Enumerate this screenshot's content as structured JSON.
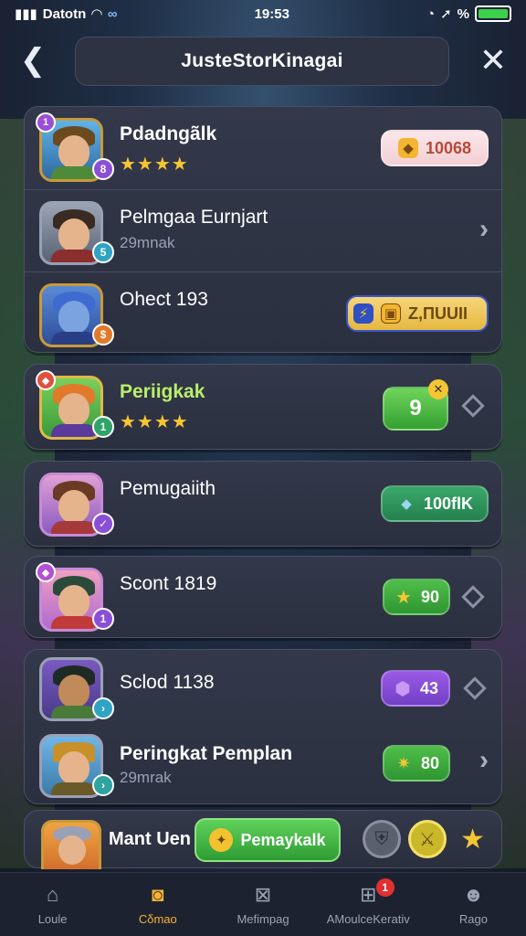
{
  "status_bar": {
    "carrier": "Datotn",
    "time": "19:53",
    "battery": "%"
  },
  "header": {
    "title": "JusteStorKinagai"
  },
  "rows": [
    {
      "name": "Pdadngãlk",
      "subtitle": "",
      "stars": "★★★★",
      "pill_value": "10068",
      "trailing": ""
    },
    {
      "name": "Pelmgaa Eurnjart",
      "subtitle": "29mnak",
      "stars": "",
      "pill_value": "",
      "trailing": "chevron"
    },
    {
      "name": "Ohect 193",
      "subtitle": "",
      "stars": "",
      "pill_value": "Z,ΠUUII",
      "trailing": ""
    },
    {
      "name": "Periigkak",
      "subtitle": "",
      "stars": "★★★★",
      "pill_value": "9",
      "trailing": "diamond"
    },
    {
      "name": "Pemugаiith",
      "subtitle": "",
      "stars": "",
      "pill_value": "100flK",
      "trailing": ""
    },
    {
      "name": "Scont 1819",
      "subtitle": "",
      "stars": "",
      "pill_value": "90",
      "trailing": "diamond"
    },
    {
      "name": "Sclod 1138",
      "subtitle": "",
      "stars": "",
      "pill_value": "43",
      "trailing": "diamond"
    },
    {
      "name": "Peringkat Pemplan",
      "subtitle": "29mrak",
      "stars": "",
      "pill_value": "80",
      "trailing": "chevron"
    }
  ],
  "bottom_strip": {
    "player_name": "Mant Uen",
    "claim_label": "Pemaykalk"
  },
  "tabs": [
    {
      "label": "Loule",
      "icon": "home-icon",
      "active": false
    },
    {
      "label": "Cδmao",
      "icon": "camera-icon",
      "active": true
    },
    {
      "label": "Mefimpag",
      "icon": "image-icon",
      "active": false
    },
    {
      "label": "AMoulceKerativ",
      "icon": "gallery-icon",
      "active": false,
      "badge": "1"
    },
    {
      "label": "Rago",
      "icon": "profile-icon",
      "active": false
    }
  ],
  "colors": {
    "gold": "#f5c632",
    "green": "#3fae3c",
    "purple": "#7d4ed1",
    "accent_tab": "#f5b331"
  }
}
